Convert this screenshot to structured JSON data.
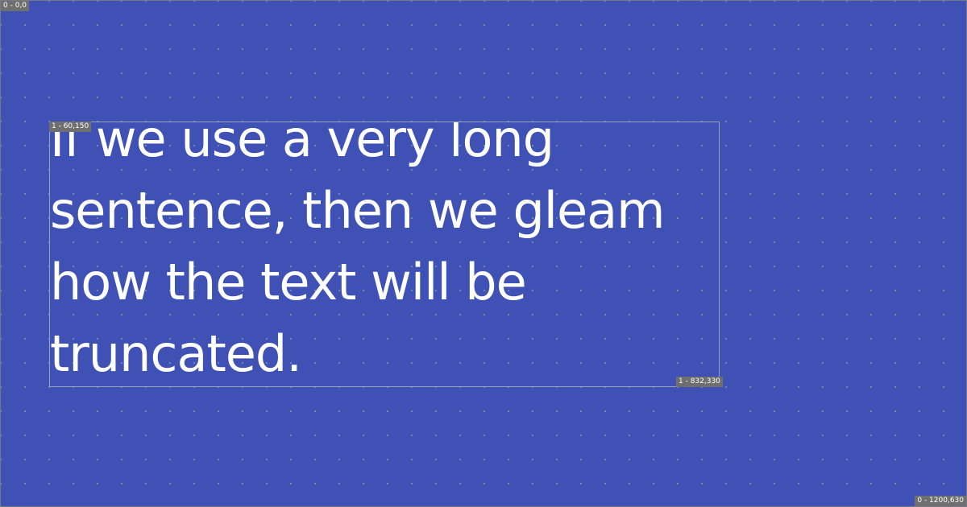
{
  "canvas": {
    "background": "#3f51b5",
    "origin_label": "0 - 0,0",
    "end_label": "0 - 1200,630"
  },
  "text_box": {
    "start_label": "1 - 60,150",
    "end_label": "1 - 832,330",
    "text": "If we use a very long sentence, then we gleam how the text will be truncated."
  }
}
